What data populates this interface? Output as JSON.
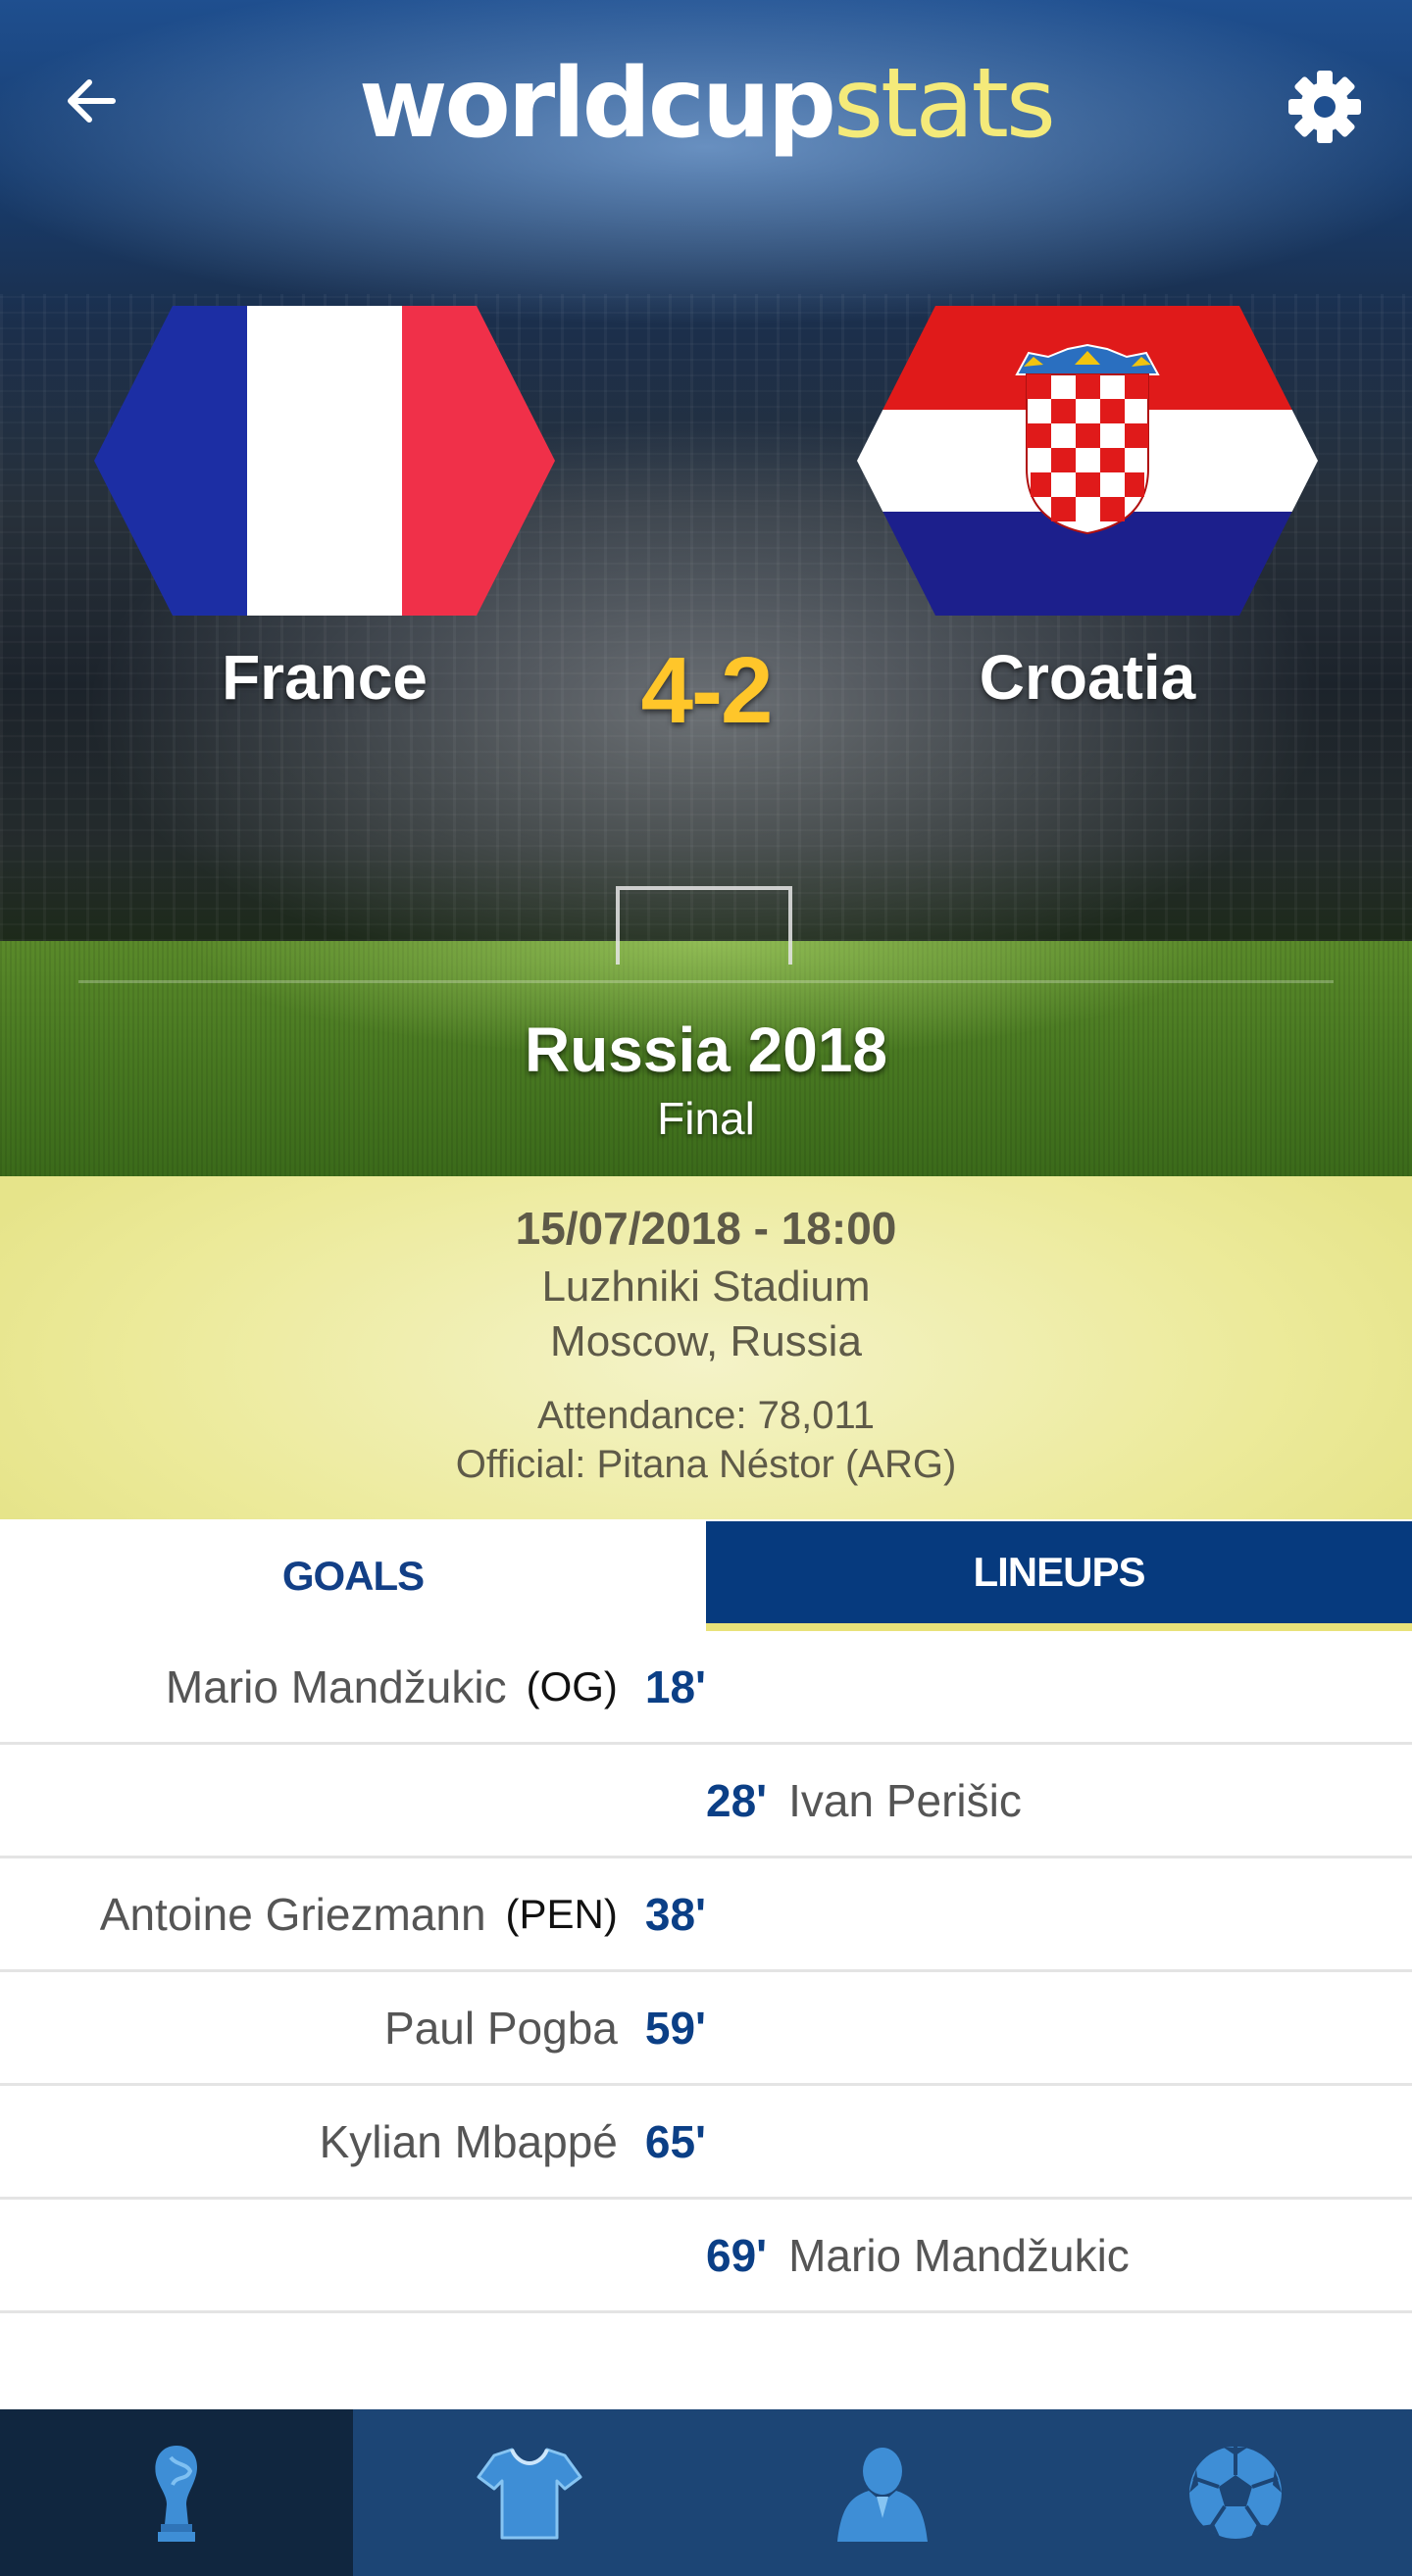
{
  "header": {
    "logo_bold": "worldcup",
    "logo_light": "stats",
    "back_icon": "arrow-left-icon",
    "settings_icon": "gear-icon"
  },
  "match": {
    "home_team": "France",
    "away_team": "Croatia",
    "score": "4-2",
    "tournament": "Russia 2018",
    "stage": "Final"
  },
  "info": {
    "datetime": "15/07/2018 - 18:00",
    "venue": "Luzhniki Stadium",
    "city": "Moscow, Russia",
    "attendance": "Attendance: 78,011",
    "official": "Official: Pitana Néstor (ARG)"
  },
  "tabs": {
    "goals": "GOALS",
    "lineups": "LINEUPS"
  },
  "goals": [
    {
      "side": "home",
      "player": "Mario Mandžukic",
      "tag": "(OG)",
      "minute": "18'"
    },
    {
      "side": "away",
      "player": "Ivan Perišic",
      "tag": "",
      "minute": "28'"
    },
    {
      "side": "home",
      "player": "Antoine Griezmann",
      "tag": "(PEN)",
      "minute": "38'"
    },
    {
      "side": "home",
      "player": "Paul Pogba",
      "tag": "",
      "minute": "59'"
    },
    {
      "side": "home",
      "player": "Kylian Mbappé",
      "tag": "",
      "minute": "65'"
    },
    {
      "side": "away",
      "player": "Mario Mandžukic",
      "tag": "",
      "minute": "69'"
    }
  ],
  "bottom_nav": [
    {
      "icon": "trophy-icon",
      "active": true
    },
    {
      "icon": "shirt-icon",
      "active": false
    },
    {
      "icon": "player-icon",
      "active": false
    },
    {
      "icon": "soccer-ball-icon",
      "active": false
    }
  ],
  "colors": {
    "accent_navy": "#063a7e",
    "score_yellow": "#ffc62a",
    "info_panel": "#ecea9a",
    "minute_blue": "#0b3f86"
  }
}
